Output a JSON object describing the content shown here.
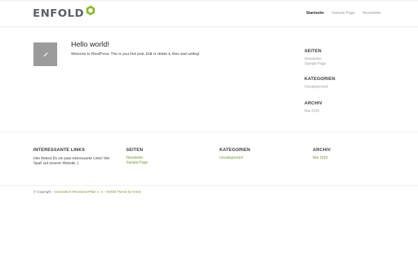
{
  "header": {
    "logo_text": "ENFOLD",
    "accent_color": "#8bba25",
    "nav": [
      {
        "label": "Startseite",
        "active": true
      },
      {
        "label": "Sample Page",
        "active": false
      },
      {
        "label": "Newsletter",
        "active": false
      }
    ]
  },
  "post": {
    "thumb_icon": "pencil-icon",
    "title": "Hello world!",
    "excerpt": "Welcome to WordPress. This is your first post. Edit or delete it, then start writing!"
  },
  "sidebar": {
    "seiten": {
      "heading": "SEITEN",
      "links": [
        "Newsletter",
        "Sample Page"
      ]
    },
    "kategorien": {
      "heading": "KATEGORIEN",
      "links": [
        "Uncategorized"
      ]
    },
    "archiv": {
      "heading": "ARCHIV",
      "links": [
        "Mai 2025"
      ]
    }
  },
  "footer": {
    "links_col": {
      "heading": "INTERESSANTE LINKS",
      "text": "Hier findest Du ein paar interessante Links! Viel Spaß auf unserer Website :)"
    },
    "seiten": {
      "heading": "SEITEN",
      "links": [
        "Newsletter",
        "Sample Page"
      ]
    },
    "kategorien": {
      "heading": "KATEGORIEN",
      "links": [
        "Uncategorized"
      ]
    },
    "archiv": {
      "heading": "ARCHIV",
      "links": [
        "Mai 2025"
      ]
    }
  },
  "copyright": {
    "prefix": "© Copyright - ",
    "site_link": "Cineastisch Rheinland-Pfalz e. V.",
    "separator": " - ",
    "theme_link": "Enfold Theme by Kriesi"
  }
}
